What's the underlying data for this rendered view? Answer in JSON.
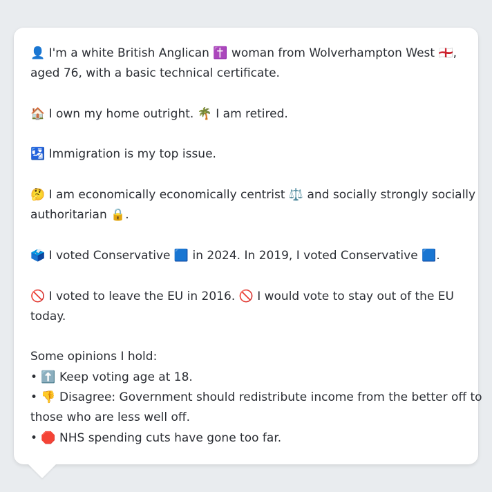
{
  "lines": [
    "👤 I'm a white British Anglican ✝️ woman from Wolverhampton West 🏴󠁧󠁢󠁥󠁮󠁧󠁿,",
    "aged 76, with a basic technical certificate.",
    "",
    "🏠 I own my home outright. 🌴 I am retired.",
    "",
    "🛂 Immigration is my top issue.",
    "",
    "🤔 I am economically economically centrist ⚖️ and socially strongly socially",
    "authoritarian 🔒.",
    "",
    "🗳️ I voted Conservative 🟦 in 2024. In 2019, I voted Conservative 🟦.",
    "",
    "🚫 I voted to leave the EU in 2016. 🚫 I would vote to stay out of the EU",
    "today.",
    "",
    "Some opinions I hold:",
    "• ⬆️ Keep voting age at 18.",
    "• 👎 Disagree: Government should redistribute income from the better off to",
    "those who are less well off.",
    "• 🛑 NHS spending cuts have gone too far."
  ]
}
